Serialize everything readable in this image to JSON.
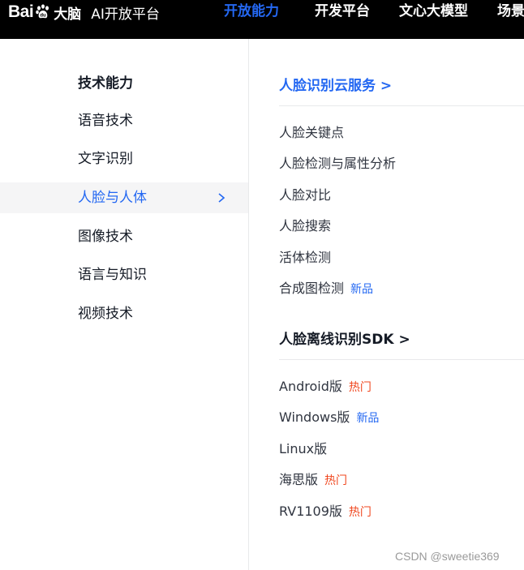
{
  "header": {
    "logo_text": "Bai",
    "logo_brain": "大脑",
    "platform_name": "AI开放平台",
    "nav": [
      {
        "label": "开放能力",
        "active": true
      },
      {
        "label": "开发平台",
        "active": false
      },
      {
        "label": "文心大模型",
        "active": false
      },
      {
        "label": "场景",
        "active": false
      }
    ]
  },
  "left": {
    "heading": "技术能力",
    "items": [
      {
        "label": "语音技术",
        "active": false
      },
      {
        "label": "文字识别",
        "active": false
      },
      {
        "label": "人脸与人体",
        "active": true
      },
      {
        "label": "图像技术",
        "active": false
      },
      {
        "label": "语言与知识",
        "active": false
      },
      {
        "label": "视频技术",
        "active": false
      }
    ]
  },
  "sections": [
    {
      "title": "人脸识别云服务 >",
      "items": [
        {
          "label": "人脸关键点",
          "badge": ""
        },
        {
          "label": "人脸检测与属性分析",
          "badge": ""
        },
        {
          "label": "人脸对比",
          "badge": ""
        },
        {
          "label": "人脸搜索",
          "badge": ""
        },
        {
          "label": "活体检测",
          "badge": ""
        },
        {
          "label": "合成图检测",
          "badge": "新品"
        }
      ]
    },
    {
      "title": "人脸离线识别SDK >",
      "items": [
        {
          "label": "Android版",
          "badge": "热门"
        },
        {
          "label": "Windows版",
          "badge": "新品"
        },
        {
          "label": "Linux版",
          "badge": ""
        },
        {
          "label": "海思版",
          "badge": "热门"
        },
        {
          "label": "RV1109版",
          "badge": "热门"
        }
      ]
    }
  ],
  "watermark": "CSDN @sweetie369",
  "colors": {
    "accent": "#2468f2",
    "hot": "#f0471f",
    "header_bg": "#000000"
  }
}
